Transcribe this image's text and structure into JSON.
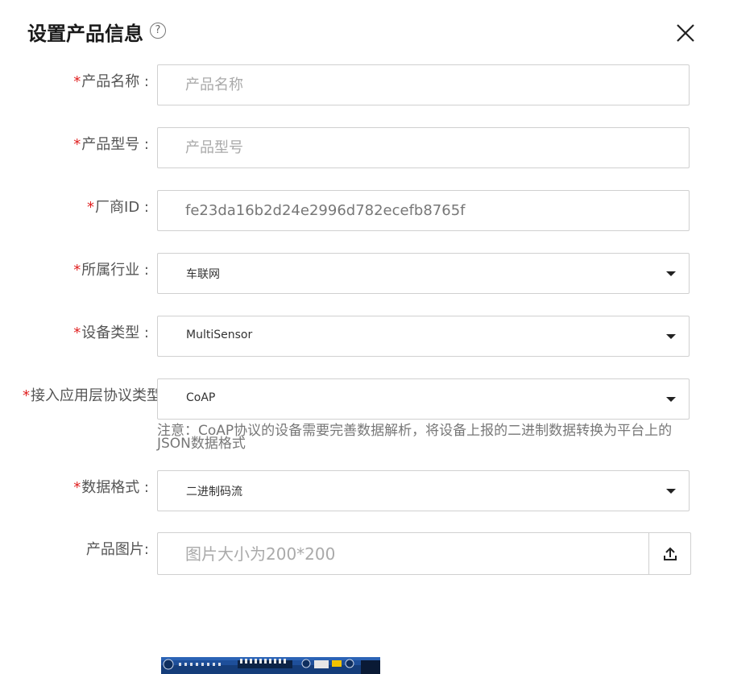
{
  "dialog": {
    "title": "设置产品信息",
    "help_glyph": "?"
  },
  "form": {
    "required_mark": "*",
    "product_name": {
      "label": "产品名称 :",
      "placeholder": "产品名称"
    },
    "product_model": {
      "label": "产品型号 :",
      "placeholder": "产品型号"
    },
    "vendor_id": {
      "label": "厂商ID :",
      "value": "fe23da16b2d24e2996d782ecefb8765f"
    },
    "industry": {
      "label": "所属行业 :",
      "value": "车联网"
    },
    "device_type": {
      "label": "设备类型 :",
      "value": "MultiSensor"
    },
    "protocol": {
      "label": "接入应用层协议类型",
      "value": "CoAP",
      "note": "注意：CoAP协议的设备需要完善数据解析，将设备上报的二进制数据转换为平台上的JSON数据格式"
    },
    "data_format": {
      "label": "数据格式 :",
      "value": "二进制码流"
    },
    "product_image": {
      "label": "产品图片:",
      "placeholder": "图片大小为200*200"
    }
  },
  "icons": {
    "close": "close-icon",
    "help": "help-circle-icon",
    "caret": "caret-down-icon",
    "upload": "upload-icon"
  },
  "colors": {
    "required": "#e02020",
    "border": "#d0d0d0",
    "title": "#1a1a1a"
  }
}
